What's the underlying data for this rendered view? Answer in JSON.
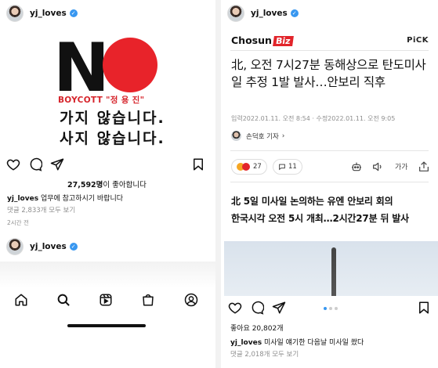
{
  "left_post": {
    "username": "yj_loves",
    "image": {
      "big_text": "N",
      "boycott_text": "BOYCOTT \"정 용 진\"",
      "line1": "가지 않습니다.",
      "line2": "사지 않습니다."
    },
    "likes_count": "27,592명",
    "likes_suffix": "이 좋아합니다",
    "caption_username": "yj_loves",
    "caption_text": "업무에 참고하시기 바랍니다",
    "comments": "댓글 2,833개 모두 보기",
    "time": "2시간 전"
  },
  "left_post2": {
    "username": "yj_loves"
  },
  "bottom_nav": [
    "home",
    "search",
    "reels",
    "shop",
    "profile"
  ],
  "right_post": {
    "username": "yj_loves",
    "article": {
      "source": "Chosun",
      "source_tag": "Biz",
      "pick": "PiCK",
      "headline": "北, 오전 7시27분 동해상으로 탄도미사일 추정 1발 발사…안보리 직후",
      "dates": "입력2022.01.11. 오전 8:54 · 수정2022.01.11. 오전 9:05",
      "reporter": "손덕호 기자",
      "reactions_count": "27",
      "comments_count": "11",
      "font_label": "가가",
      "subhead1": "北 5일 미사일 논의하는 유엔 안보리 회의",
      "subhead2": "한국시각 오전 5시 개최…2시간27분 뒤 발사"
    },
    "likes": "좋아요 20,802개",
    "caption_username": "yj_loves",
    "caption_text": "미사일 얘기한 다음날 미사일 쐈다",
    "comments": "댓글 2,018개 모두 보기"
  },
  "colors": {
    "verified": "#3897f0",
    "boycott_red": "#d6242b",
    "sun_red": "#e8232a",
    "biz_red": "#e2242a"
  }
}
